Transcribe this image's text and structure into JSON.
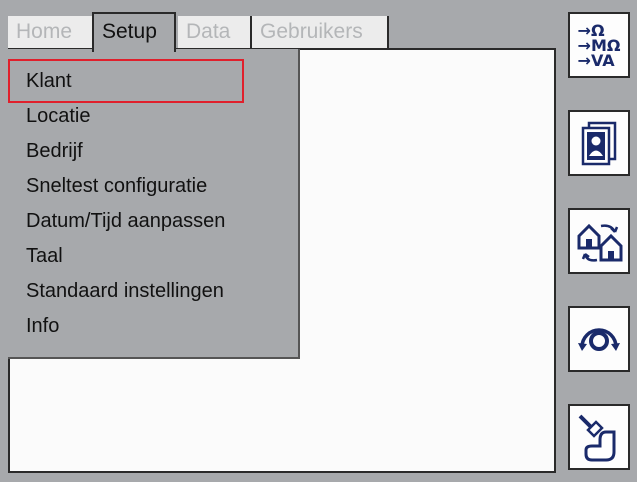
{
  "tabs": [
    {
      "label": "Home",
      "active": false
    },
    {
      "label": "Setup",
      "active": true
    },
    {
      "label": "Data",
      "active": false
    },
    {
      "label": "Gebruikers",
      "active": false
    }
  ],
  "menu": {
    "items": [
      "Klant",
      "Locatie",
      "Bedrijf",
      "Sneltest configuratie",
      "Datum/Tijd aanpassen",
      "Taal",
      "Standaard instellingen",
      "Info"
    ],
    "selected_index": 0
  },
  "sidebar": {
    "buttons": [
      {
        "icon": "measurement-units-icon",
        "lines": [
          "→Ω",
          "→MΩ",
          "→VA"
        ]
      },
      {
        "icon": "user-profiles-icon"
      },
      {
        "icon": "transfer-sites-icon"
      },
      {
        "icon": "rotate-circle-icon"
      },
      {
        "icon": "probe-tool-icon"
      }
    ]
  },
  "colors": {
    "background": "#a7a9ac",
    "selection_outline": "#e0202c",
    "icon_blue": "#1a2a6a",
    "inactive_tab_text": "#b4b6b8"
  }
}
